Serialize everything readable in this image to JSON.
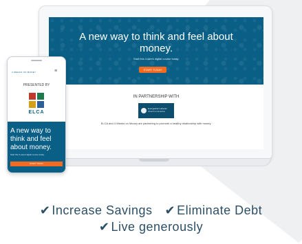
{
  "laptop": {
    "hero_title": "A new way to think and feel about money.",
    "hero_subtitle": "Start this 4-week digital course today.",
    "hero_button": "START TODAY",
    "partner_heading": "IN PARTNERSHIP WITH",
    "partner_logo": "Evangelical Lutheran Church in America",
    "partner_text": "ELCA and 4 Weeks on Money are partnering to promote a healthy relationship with money."
  },
  "phone": {
    "brand": "4 WEEKS ON MONEY",
    "menu_icon": "≡",
    "presented_by": "PRESENTED BY",
    "org_name": "ELCA",
    "hero_title": "A new way to think and feel about money.",
    "hero_subtitle": "Start this 4-week digital course today.",
    "hero_button": "START TODAY"
  },
  "benefits": {
    "check_icon": "✔",
    "items": [
      "Increase Savings",
      "Eliminate Debt",
      "Live generously"
    ]
  },
  "colors": {
    "brand_blue": "#0a5f86",
    "accent_orange": "#f26b21",
    "text_blue": "#2c4f66"
  }
}
